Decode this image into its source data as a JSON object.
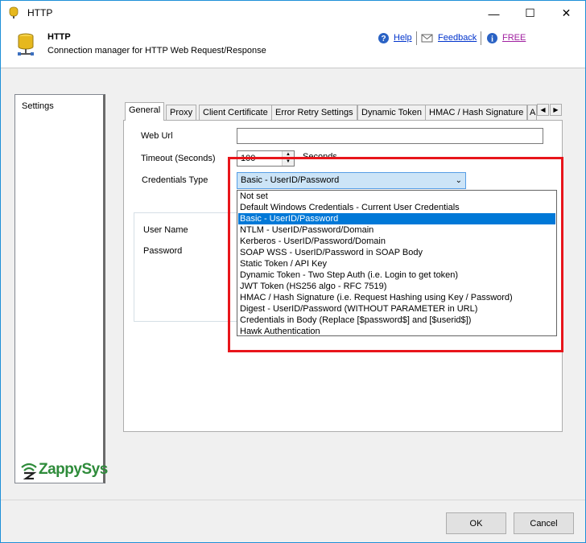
{
  "window": {
    "title": "HTTP",
    "controls": {
      "minimize": "—",
      "maximize": "☐",
      "close": "✕"
    }
  },
  "header": {
    "title": "HTTP",
    "subtitle": "Connection manager for HTTP Web Request/Response",
    "links": {
      "help": "Help",
      "feedback": "Feedback",
      "free": "FREE"
    }
  },
  "sidebar": {
    "items": [
      {
        "label": "Settings"
      }
    ]
  },
  "tabs": [
    {
      "label": "General",
      "active": true
    },
    {
      "label": "Proxy"
    },
    {
      "label": "Client Certificate"
    },
    {
      "label": "Error Retry Settings"
    },
    {
      "label": "Dynamic Token"
    },
    {
      "label": "HMAC / Hash Signature"
    },
    {
      "label": "A"
    }
  ],
  "form": {
    "web_url_label": "Web Url",
    "web_url_value": "",
    "timeout_label": "Timeout (Seconds)",
    "timeout_value": "100",
    "timeout_unit": "Seconds",
    "credentials_label": "Credentials Type",
    "credentials_value": "Basic - UserID/Password",
    "user_name_label": "User Name",
    "password_label": "Password"
  },
  "credentials_options": [
    "Not set",
    "Default Windows Credentials - Current User Credentials",
    "Basic - UserID/Password",
    "NTLM - UserID/Password/Domain",
    "Kerberos - UserID/Password/Domain",
    "SOAP WSS - UserID/Password in SOAP Body",
    "Static Token / API Key",
    "Dynamic Token - Two Step Auth (i.e. Login to get token)",
    "JWT Token (HS256 algo - RFC 7519)",
    "HMAC / Hash Signature (i.e. Request Hashing using Key / Password)",
    "Digest - UserID/Password (WITHOUT PARAMETER in URL)",
    "Credentials in Body (Replace [$password$] and [$userid$])",
    "Hawk Authentication"
  ],
  "selected_option_index": 2,
  "logo_text": "ZappySys",
  "buttons": {
    "ok": "OK",
    "cancel": "Cancel"
  },
  "colors": {
    "selection": "#0078d7",
    "highlight_box": "#e8151b",
    "link": "#0033cc",
    "free_link": "#a020a0",
    "logo_green": "#2e8b3a"
  }
}
